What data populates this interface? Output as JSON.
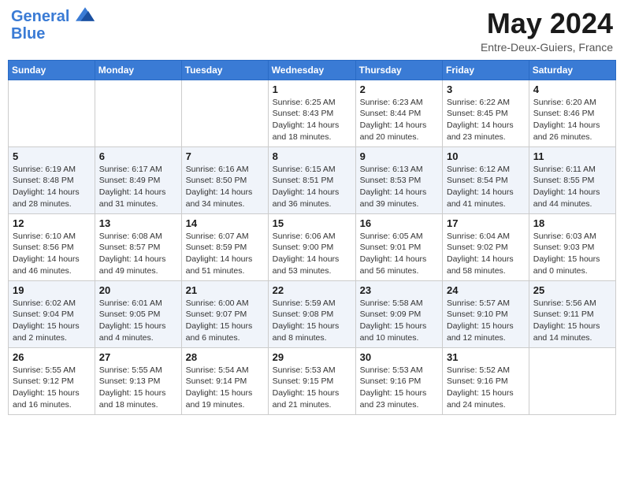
{
  "header": {
    "logo_line1": "General",
    "logo_line2": "Blue",
    "month_title": "May 2024",
    "location": "Entre-Deux-Guiers, France"
  },
  "days_of_week": [
    "Sunday",
    "Monday",
    "Tuesday",
    "Wednesday",
    "Thursday",
    "Friday",
    "Saturday"
  ],
  "weeks": [
    [
      {
        "day": "",
        "info": ""
      },
      {
        "day": "",
        "info": ""
      },
      {
        "day": "",
        "info": ""
      },
      {
        "day": "1",
        "info": "Sunrise: 6:25 AM\nSunset: 8:43 PM\nDaylight: 14 hours\nand 18 minutes."
      },
      {
        "day": "2",
        "info": "Sunrise: 6:23 AM\nSunset: 8:44 PM\nDaylight: 14 hours\nand 20 minutes."
      },
      {
        "day": "3",
        "info": "Sunrise: 6:22 AM\nSunset: 8:45 PM\nDaylight: 14 hours\nand 23 minutes."
      },
      {
        "day": "4",
        "info": "Sunrise: 6:20 AM\nSunset: 8:46 PM\nDaylight: 14 hours\nand 26 minutes."
      }
    ],
    [
      {
        "day": "5",
        "info": "Sunrise: 6:19 AM\nSunset: 8:48 PM\nDaylight: 14 hours\nand 28 minutes."
      },
      {
        "day": "6",
        "info": "Sunrise: 6:17 AM\nSunset: 8:49 PM\nDaylight: 14 hours\nand 31 minutes."
      },
      {
        "day": "7",
        "info": "Sunrise: 6:16 AM\nSunset: 8:50 PM\nDaylight: 14 hours\nand 34 minutes."
      },
      {
        "day": "8",
        "info": "Sunrise: 6:15 AM\nSunset: 8:51 PM\nDaylight: 14 hours\nand 36 minutes."
      },
      {
        "day": "9",
        "info": "Sunrise: 6:13 AM\nSunset: 8:53 PM\nDaylight: 14 hours\nand 39 minutes."
      },
      {
        "day": "10",
        "info": "Sunrise: 6:12 AM\nSunset: 8:54 PM\nDaylight: 14 hours\nand 41 minutes."
      },
      {
        "day": "11",
        "info": "Sunrise: 6:11 AM\nSunset: 8:55 PM\nDaylight: 14 hours\nand 44 minutes."
      }
    ],
    [
      {
        "day": "12",
        "info": "Sunrise: 6:10 AM\nSunset: 8:56 PM\nDaylight: 14 hours\nand 46 minutes."
      },
      {
        "day": "13",
        "info": "Sunrise: 6:08 AM\nSunset: 8:57 PM\nDaylight: 14 hours\nand 49 minutes."
      },
      {
        "day": "14",
        "info": "Sunrise: 6:07 AM\nSunset: 8:59 PM\nDaylight: 14 hours\nand 51 minutes."
      },
      {
        "day": "15",
        "info": "Sunrise: 6:06 AM\nSunset: 9:00 PM\nDaylight: 14 hours\nand 53 minutes."
      },
      {
        "day": "16",
        "info": "Sunrise: 6:05 AM\nSunset: 9:01 PM\nDaylight: 14 hours\nand 56 minutes."
      },
      {
        "day": "17",
        "info": "Sunrise: 6:04 AM\nSunset: 9:02 PM\nDaylight: 14 hours\nand 58 minutes."
      },
      {
        "day": "18",
        "info": "Sunrise: 6:03 AM\nSunset: 9:03 PM\nDaylight: 15 hours\nand 0 minutes."
      }
    ],
    [
      {
        "day": "19",
        "info": "Sunrise: 6:02 AM\nSunset: 9:04 PM\nDaylight: 15 hours\nand 2 minutes."
      },
      {
        "day": "20",
        "info": "Sunrise: 6:01 AM\nSunset: 9:05 PM\nDaylight: 15 hours\nand 4 minutes."
      },
      {
        "day": "21",
        "info": "Sunrise: 6:00 AM\nSunset: 9:07 PM\nDaylight: 15 hours\nand 6 minutes."
      },
      {
        "day": "22",
        "info": "Sunrise: 5:59 AM\nSunset: 9:08 PM\nDaylight: 15 hours\nand 8 minutes."
      },
      {
        "day": "23",
        "info": "Sunrise: 5:58 AM\nSunset: 9:09 PM\nDaylight: 15 hours\nand 10 minutes."
      },
      {
        "day": "24",
        "info": "Sunrise: 5:57 AM\nSunset: 9:10 PM\nDaylight: 15 hours\nand 12 minutes."
      },
      {
        "day": "25",
        "info": "Sunrise: 5:56 AM\nSunset: 9:11 PM\nDaylight: 15 hours\nand 14 minutes."
      }
    ],
    [
      {
        "day": "26",
        "info": "Sunrise: 5:55 AM\nSunset: 9:12 PM\nDaylight: 15 hours\nand 16 minutes."
      },
      {
        "day": "27",
        "info": "Sunrise: 5:55 AM\nSunset: 9:13 PM\nDaylight: 15 hours\nand 18 minutes."
      },
      {
        "day": "28",
        "info": "Sunrise: 5:54 AM\nSunset: 9:14 PM\nDaylight: 15 hours\nand 19 minutes."
      },
      {
        "day": "29",
        "info": "Sunrise: 5:53 AM\nSunset: 9:15 PM\nDaylight: 15 hours\nand 21 minutes."
      },
      {
        "day": "30",
        "info": "Sunrise: 5:53 AM\nSunset: 9:16 PM\nDaylight: 15 hours\nand 23 minutes."
      },
      {
        "day": "31",
        "info": "Sunrise: 5:52 AM\nSunset: 9:16 PM\nDaylight: 15 hours\nand 24 minutes."
      },
      {
        "day": "",
        "info": ""
      }
    ]
  ]
}
